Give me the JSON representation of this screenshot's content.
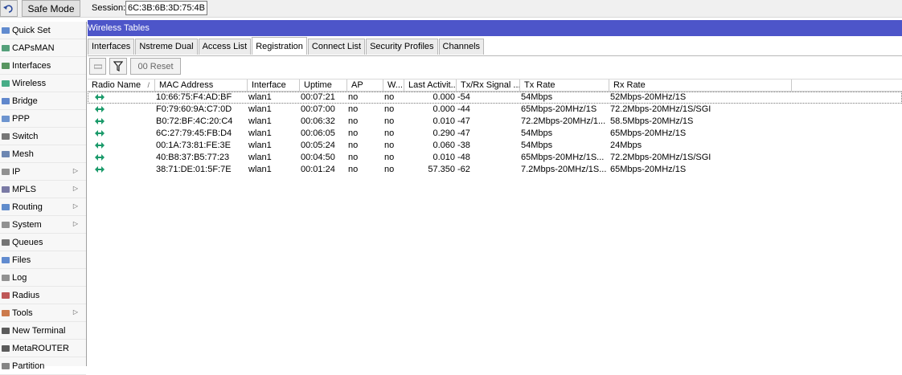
{
  "toolbar": {
    "undo_icon": "undo-icon",
    "safe_mode_label": "Safe Mode",
    "session_label": "Session:",
    "session_value": "6C:3B:6B:3D:75:4B"
  },
  "sidebar": {
    "items": [
      {
        "label": "Quick Set",
        "icon": "quickset-icon",
        "submenu": false
      },
      {
        "label": "CAPsMAN",
        "icon": "capsman-icon",
        "submenu": false
      },
      {
        "label": "Interfaces",
        "icon": "interfaces-icon",
        "submenu": false
      },
      {
        "label": "Wireless",
        "icon": "wireless-icon",
        "submenu": false
      },
      {
        "label": "Bridge",
        "icon": "bridge-icon",
        "submenu": false
      },
      {
        "label": "PPP",
        "icon": "ppp-icon",
        "submenu": false
      },
      {
        "label": "Switch",
        "icon": "switch-icon",
        "submenu": false
      },
      {
        "label": "Mesh",
        "icon": "mesh-icon",
        "submenu": false
      },
      {
        "label": "IP",
        "icon": "ip-icon",
        "submenu": true
      },
      {
        "label": "MPLS",
        "icon": "mpls-icon",
        "submenu": true
      },
      {
        "label": "Routing",
        "icon": "routing-icon",
        "submenu": true
      },
      {
        "label": "System",
        "icon": "system-icon",
        "submenu": true
      },
      {
        "label": "Queues",
        "icon": "queues-icon",
        "submenu": false
      },
      {
        "label": "Files",
        "icon": "files-icon",
        "submenu": false
      },
      {
        "label": "Log",
        "icon": "log-icon",
        "submenu": false
      },
      {
        "label": "Radius",
        "icon": "radius-icon",
        "submenu": false
      },
      {
        "label": "Tools",
        "icon": "tools-icon",
        "submenu": true
      },
      {
        "label": "New Terminal",
        "icon": "terminal-icon",
        "submenu": false
      },
      {
        "label": "MetaROUTER",
        "icon": "metarouter-icon",
        "submenu": false
      },
      {
        "label": "Partition",
        "icon": "partition-icon",
        "submenu": false
      }
    ]
  },
  "window": {
    "title": "Wireless Tables",
    "tabs": [
      "Interfaces",
      "Nstreme Dual",
      "Access List",
      "Registration",
      "Connect List",
      "Security Profiles",
      "Channels"
    ],
    "active_tab": "Registration",
    "buttons": {
      "reset_label": "00 Reset"
    }
  },
  "table": {
    "columns": [
      "Radio Name",
      "MAC Address",
      "Interface",
      "Uptime",
      "AP",
      "W...",
      "Last Activit...",
      "Tx/Rx Signal ...",
      "Tx Rate",
      "Rx Rate"
    ],
    "rows": [
      [
        "",
        "10:66:75:F4:AD:BF",
        "wlan1",
        "00:07:21",
        "no",
        "no",
        "0.000",
        "-54",
        "54Mbps",
        "52Mbps-20MHz/1S"
      ],
      [
        "",
        "F0:79:60:9A:C7:0D",
        "wlan1",
        "00:07:00",
        "no",
        "no",
        "0.000",
        "-44",
        "65Mbps-20MHz/1S",
        "72.2Mbps-20MHz/1S/SGI"
      ],
      [
        "",
        "B0:72:BF:4C:20:C4",
        "wlan1",
        "00:06:32",
        "no",
        "no",
        "0.010",
        "-47",
        "72.2Mbps-20MHz/1...",
        "58.5Mbps-20MHz/1S"
      ],
      [
        "",
        "6C:27:79:45:FB:D4",
        "wlan1",
        "00:06:05",
        "no",
        "no",
        "0.290",
        "-47",
        "54Mbps",
        "65Mbps-20MHz/1S"
      ],
      [
        "",
        "00:1A:73:81:FE:3E",
        "wlan1",
        "00:05:24",
        "no",
        "no",
        "0.060",
        "-38",
        "54Mbps",
        "24Mbps"
      ],
      [
        "",
        "40:B8:37:B5:77:23",
        "wlan1",
        "00:04:50",
        "no",
        "no",
        "0.010",
        "-48",
        "65Mbps-20MHz/1S...",
        "72.2Mbps-20MHz/1S/SGI"
      ],
      [
        "",
        "38:71:DE:01:5F:7E",
        "wlan1",
        "00:01:24",
        "no",
        "no",
        "57.350",
        "-62",
        "7.2Mbps-20MHz/1S...",
        "65Mbps-20MHz/1S"
      ]
    ]
  },
  "colors": {
    "title_bar": "#4d55c9",
    "radio_icon": "#1a9a6a"
  }
}
